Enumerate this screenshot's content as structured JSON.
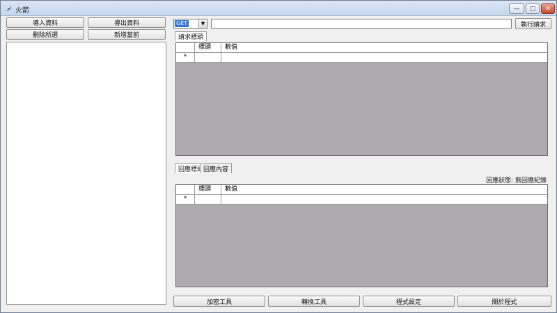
{
  "window": {
    "title": "火箭",
    "minimize": "—",
    "maximize": "▢",
    "close": "✕"
  },
  "left_panel": {
    "import_label": "導入資料",
    "export_label": "導出資料",
    "delete_label": "刪除所選",
    "add_label": "新增當前"
  },
  "request": {
    "method": "GET",
    "url": "",
    "execute_label": "執行請求",
    "tab_label": "請求標頭",
    "grid": {
      "col_header": "標頭",
      "col_value": "數值",
      "row_marker": "*"
    }
  },
  "response": {
    "tab_headers_label": "回應標頭",
    "tab_body_label": "回應內容",
    "status": "回應狀態: 無回應紀錄",
    "grid": {
      "col_header": "標頭",
      "col_value": "數值",
      "row_marker": "*"
    }
  },
  "footer": {
    "encrypt_label": "加密工具",
    "convert_label": "轉換工具",
    "settings_label": "程式設定",
    "about_label": "關於程式"
  }
}
